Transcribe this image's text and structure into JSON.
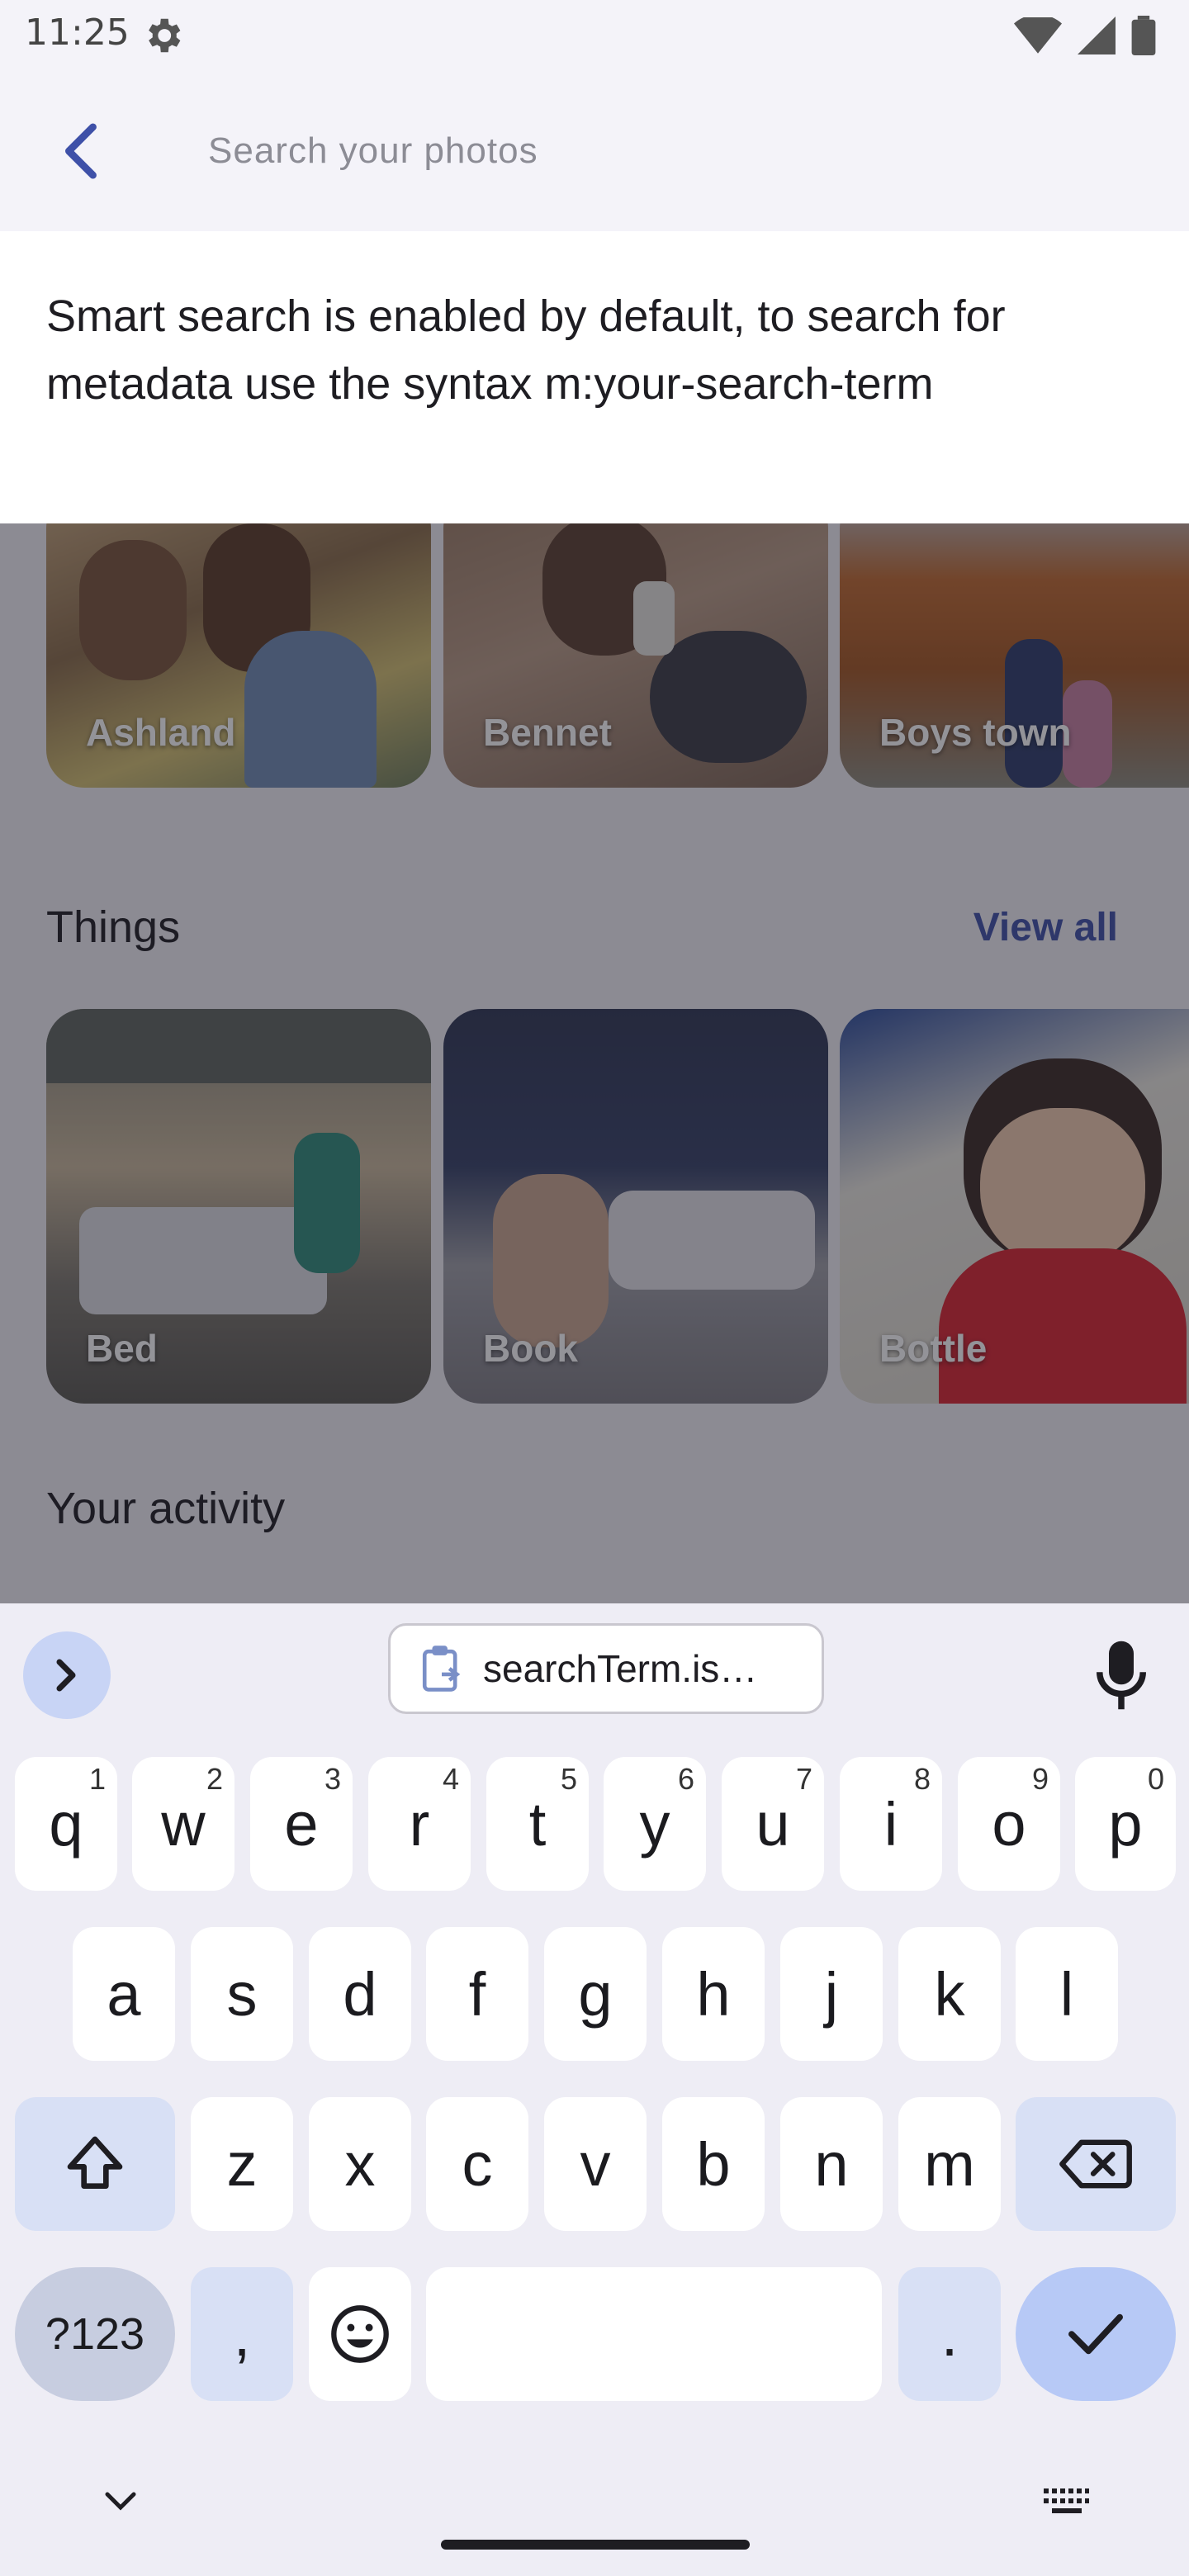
{
  "status_bar": {
    "time": "11:25",
    "icons": [
      "gear-icon",
      "wifi-icon",
      "signal-icon",
      "battery-icon"
    ]
  },
  "search": {
    "back_icon": "arrow-back-icon",
    "placeholder": "Search your photos",
    "value": ""
  },
  "hint": {
    "text": "Smart search is enabled by default, to search for metadata use the syntax m:your-search-term"
  },
  "places": {
    "items": [
      {
        "label": "Ashland"
      },
      {
        "label": "Bennet"
      },
      {
        "label": "Boys town"
      }
    ]
  },
  "things": {
    "title": "Things",
    "view_all": "View all",
    "items": [
      {
        "label": "Bed"
      },
      {
        "label": "Book"
      },
      {
        "label": "Bottle"
      }
    ]
  },
  "activity": {
    "title": "Your activity"
  },
  "keyboard": {
    "clipboard_suggestion": "searchTerm.is…",
    "row1": [
      {
        "key": "q",
        "hint": "1"
      },
      {
        "key": "w",
        "hint": "2"
      },
      {
        "key": "e",
        "hint": "3"
      },
      {
        "key": "r",
        "hint": "4"
      },
      {
        "key": "t",
        "hint": "5"
      },
      {
        "key": "y",
        "hint": "6"
      },
      {
        "key": "u",
        "hint": "7"
      },
      {
        "key": "i",
        "hint": "8"
      },
      {
        "key": "o",
        "hint": "9"
      },
      {
        "key": "p",
        "hint": "0"
      }
    ],
    "row2": [
      "a",
      "s",
      "d",
      "f",
      "g",
      "h",
      "j",
      "k",
      "l"
    ],
    "row3": [
      "z",
      "x",
      "c",
      "v",
      "b",
      "n",
      "m"
    ],
    "symbols_key": "?123",
    "comma_key": ",",
    "period_key": ".",
    "colors": {
      "accent": "#b7c9f6",
      "function_key": "#d8e0f5",
      "link": "#3e50a8"
    }
  }
}
